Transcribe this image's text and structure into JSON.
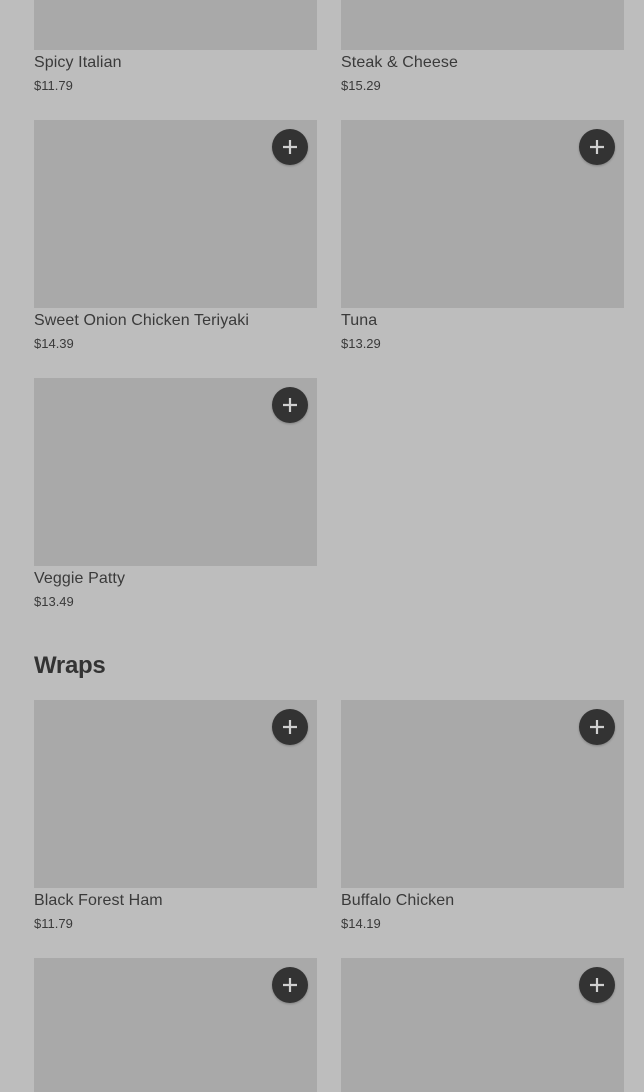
{
  "sections": {
    "top": {
      "items": [
        {
          "name": "Spicy Italian",
          "price": "$11.79"
        },
        {
          "name": "Steak & Cheese",
          "price": "$15.29"
        },
        {
          "name": "Sweet Onion Chicken Teriyaki",
          "price": "$14.39"
        },
        {
          "name": "Tuna",
          "price": "$13.29"
        },
        {
          "name": "Veggie Patty",
          "price": "$13.49"
        }
      ]
    },
    "wraps": {
      "title": "Wraps",
      "items": [
        {
          "name": "Black Forest Ham",
          "price": "$11.79"
        },
        {
          "name": "Buffalo Chicken",
          "price": "$14.19"
        }
      ]
    }
  },
  "icons": {
    "add": "plus-icon"
  },
  "colors": {
    "background": "#bdbdbd",
    "thumbnail": "#a9a9a9",
    "add_button": "#333333",
    "text": "#333333"
  }
}
